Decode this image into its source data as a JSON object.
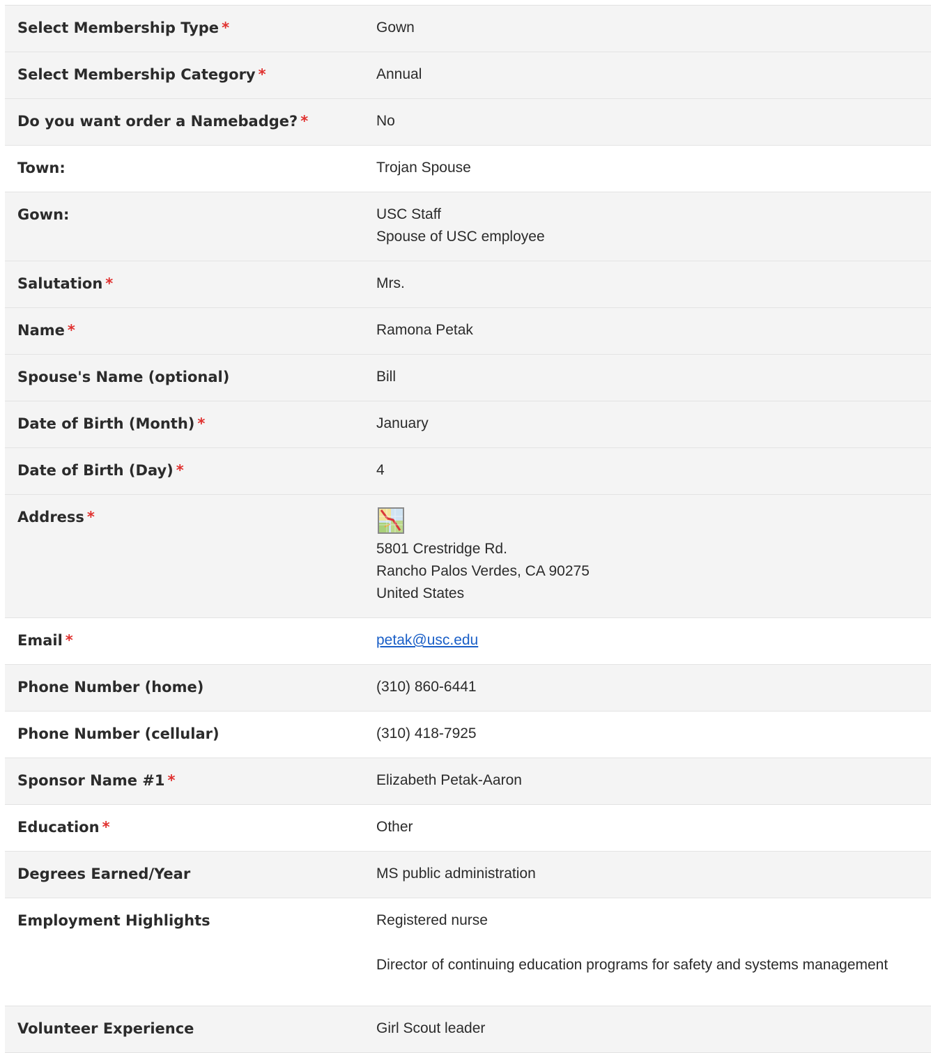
{
  "rows": [
    {
      "label": "Select Membership Type",
      "required": true,
      "value": "Gown"
    },
    {
      "label": "Select Membership Category",
      "required": true,
      "value": "Annual"
    },
    {
      "label": "Do you want order a Namebadge?",
      "required": true,
      "value": "No"
    },
    {
      "label": "Town:",
      "required": false,
      "value": "Trojan Spouse"
    },
    {
      "label": "Gown:",
      "required": false,
      "lines": [
        "USC Staff",
        "Spouse of USC employee"
      ]
    },
    {
      "label": "Salutation",
      "required": true,
      "value": "Mrs."
    },
    {
      "label": "Name",
      "required": true,
      "value": "Ramona Petak"
    },
    {
      "label": "Spouse's Name (optional)",
      "required": false,
      "value": "Bill"
    },
    {
      "label": "Date of Birth (Month)",
      "required": true,
      "value": "January"
    },
    {
      "label": "Date of Birth (Day)",
      "required": true,
      "value": "4"
    },
    {
      "label": "Address",
      "required": true,
      "icon": "map-icon",
      "lines": [
        "5801 Crestridge Rd.",
        "Rancho Palos Verdes, CA 90275",
        "United States"
      ]
    },
    {
      "label": "Email",
      "required": true,
      "link": "petak@usc.edu"
    },
    {
      "label": "Phone Number (home)",
      "required": false,
      "value": "(310) 860-6441"
    },
    {
      "label": "Phone Number (cellular)",
      "required": false,
      "value": "(310) 418-7925"
    },
    {
      "label": "Sponsor Name #1",
      "required": true,
      "value": "Elizabeth Petak-Aaron"
    },
    {
      "label": "Education",
      "required": true,
      "value": "Other"
    },
    {
      "label": "Degrees Earned/Year",
      "required": false,
      "value": "MS public administration"
    },
    {
      "label": "Employment Highlights",
      "required": false,
      "paragraphs": [
        "Registered nurse",
        "Director of continuing education programs for safety and systems management"
      ]
    },
    {
      "label": "Volunteer Experience",
      "required": false,
      "value": "Girl Scout leader"
    }
  ],
  "required_marker": "*",
  "colors": {
    "required": "#e0312f",
    "link": "#1a5fc7",
    "row_alt": "#f4f4f4"
  }
}
